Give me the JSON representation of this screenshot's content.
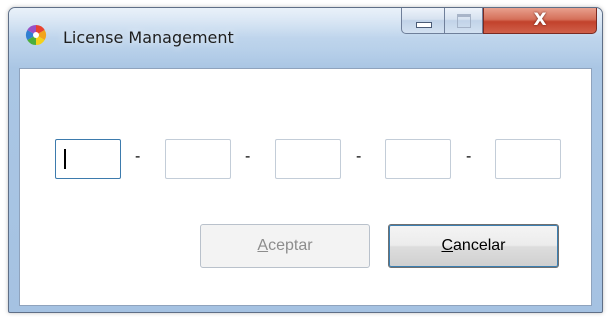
{
  "window": {
    "title": "License Management",
    "icon": "pinwheel-app-icon",
    "caption": {
      "minimize_icon": "minimize-icon",
      "maximize_icon": "maximize-icon",
      "close_label": "X"
    }
  },
  "license_key": {
    "segments": [
      "",
      "",
      "",
      "",
      ""
    ],
    "separator": "-",
    "focused_segment": 1
  },
  "buttons": {
    "accept": {
      "mnemonic": "A",
      "rest": "ceptar",
      "enabled": false
    },
    "cancel": {
      "mnemonic": "C",
      "rest": "ancelar",
      "enabled": true
    }
  },
  "colors": {
    "titlebar": "#b9d1ea",
    "close_button": "#c2422c",
    "focus_border": "#3d7bad",
    "disabled_text": "#8d8d8d"
  }
}
